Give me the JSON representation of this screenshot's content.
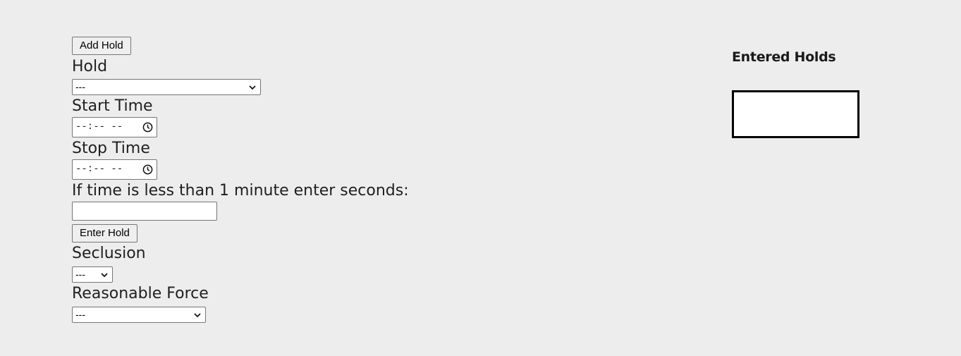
{
  "form": {
    "add_hold_button": "Add Hold",
    "hold_label": "Hold",
    "hold_select_value": "---",
    "start_time_label": "Start Time",
    "start_time_value": "--:-- --",
    "stop_time_label": "Stop Time",
    "stop_time_value": "--:-- --",
    "seconds_label": "If time is less than 1 minute enter seconds:",
    "seconds_value": "",
    "enter_hold_button": "Enter Hold",
    "seclusion_label": "Seclusion",
    "seclusion_select_value": "---",
    "reasonable_force_label": "Reasonable Force",
    "reasonable_force_select_value": "---"
  },
  "panel": {
    "title": "Entered Holds",
    "entries": []
  },
  "icons": {
    "dropdown": "chevron-down-icon",
    "time": "clock-icon"
  }
}
